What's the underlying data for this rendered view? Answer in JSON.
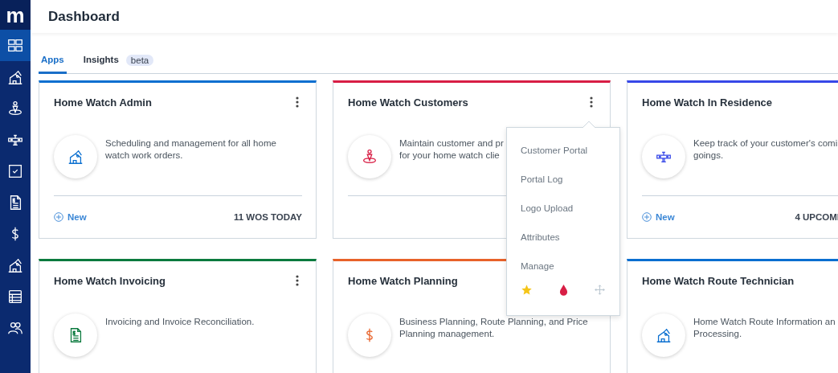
{
  "sidebar": {
    "logo": "m",
    "items": [
      {
        "kind": "grid",
        "selected": true
      },
      {
        "kind": "house",
        "selected": false
      },
      {
        "kind": "person-pin",
        "selected": false
      },
      {
        "kind": "plane",
        "selected": false
      },
      {
        "kind": "check",
        "selected": false
      },
      {
        "kind": "invoice",
        "selected": false
      },
      {
        "kind": "dollar",
        "selected": false
      },
      {
        "kind": "house",
        "selected": false
      },
      {
        "kind": "list",
        "selected": false
      },
      {
        "kind": "people",
        "selected": false
      }
    ]
  },
  "header": {
    "title": "Dashboard"
  },
  "tabs": [
    {
      "label": "Apps",
      "selected": true
    },
    {
      "label": "Insights",
      "badge": "beta",
      "selected": false
    }
  ],
  "cards": [
    {
      "title": "Home Watch Admin",
      "color": "#0a6fd0",
      "kind": "house",
      "menu": true,
      "description": [
        "Scheduling and management for all home",
        "watch work orders."
      ],
      "footer": {
        "action": "New",
        "count": "11 WOS TODAY"
      }
    },
    {
      "title": "Home Watch Customers",
      "color": "#d81e45",
      "kind": "person-pin",
      "menu": true,
      "description": [
        "Maintain customer and pr",
        "for your home watch clie"
      ]
    },
    {
      "title": "Home Watch In Residence",
      "color": "#3748e8",
      "kind": "plane",
      "description": [
        "Keep track of your customer's comi",
        "goings."
      ],
      "footer": {
        "action": "New",
        "count": "4 UPCOMI"
      }
    },
    {
      "title": "Home Watch Invoicing",
      "color": "#0b7a3e",
      "kind": "invoice",
      "menu": true,
      "description": [
        "Invoicing and Invoice Reconciliation."
      ]
    },
    {
      "title": "Home Watch Planning",
      "color": "#e8622a",
      "kind": "dollar",
      "description": [
        "Business Planning, Route Planning, and Price",
        "Planning management."
      ]
    },
    {
      "title": "Home Watch Route Technician",
      "color": "#0a6fd0",
      "kind": "house",
      "description": [
        "Home Watch Route Information an",
        "Processing."
      ]
    }
  ],
  "menu": {
    "items": [
      "Customer Portal",
      "Portal Log",
      "Logo Upload",
      "Attributes",
      "Manage"
    ],
    "tools": [
      {
        "kind": "star"
      },
      {
        "kind": "drop"
      },
      {
        "kind": "move"
      }
    ]
  }
}
